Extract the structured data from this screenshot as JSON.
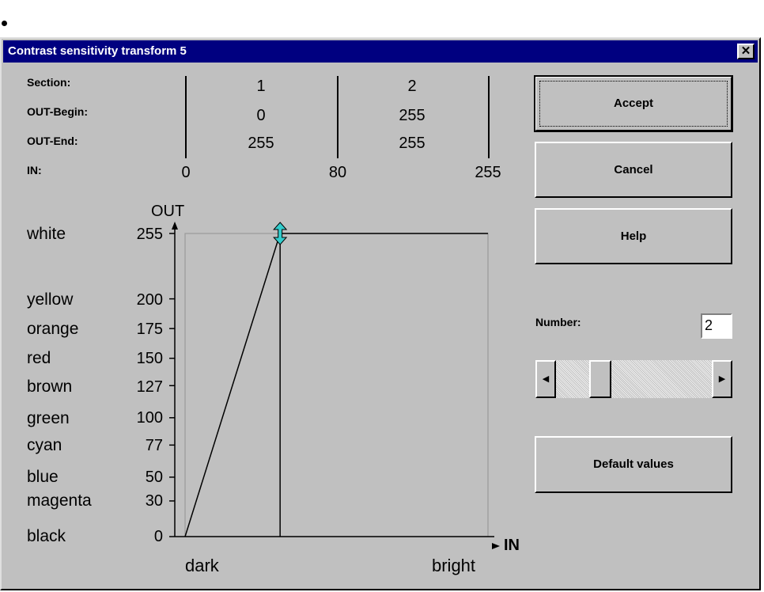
{
  "window": {
    "title": "Contrast sensitivity transform 5",
    "close_glyph": "✕"
  },
  "rows": {
    "section": "Section:",
    "out_begin": "OUT-Begin:",
    "out_end": "OUT-End:",
    "in": "IN:"
  },
  "sections": [
    {
      "number": "1",
      "out_begin": "0",
      "out_end": "255"
    },
    {
      "number": "2",
      "out_begin": "255",
      "out_end": "255"
    }
  ],
  "in_boundaries": [
    "0",
    "80",
    "255"
  ],
  "buttons": {
    "accept": "Accept",
    "cancel": "Cancel",
    "help": "Help",
    "default_values": "Default values"
  },
  "number_field": {
    "label": "Number:",
    "value": "2"
  },
  "scrollbar": {
    "left_arrow": "◀",
    "right_arrow": "▶",
    "position": 0.25
  },
  "graph": {
    "y_axis_label": "OUT",
    "x_axis_label": "IN",
    "x_left": "dark",
    "x_right": "bright",
    "levels": [
      {
        "color": "white",
        "value": "255"
      },
      {
        "color": "yellow",
        "value": "200"
      },
      {
        "color": "orange",
        "value": "175"
      },
      {
        "color": "red",
        "value": "150"
      },
      {
        "color": "brown",
        "value": "127"
      },
      {
        "color": "green",
        "value": "100"
      },
      {
        "color": "cyan",
        "value": "77"
      },
      {
        "color": "blue",
        "value": "50"
      },
      {
        "color": "magenta",
        "value": "30"
      },
      {
        "color": "black",
        "value": "0"
      }
    ],
    "curve_points": [
      [
        0,
        0
      ],
      [
        80,
        255
      ],
      [
        255,
        255
      ]
    ],
    "handle_icon": "vertical-double-arrow-icon",
    "handle_color": "#33cccc"
  },
  "colors": {
    "title_bar": "#000080",
    "dialog_bg": "#c0c0c0"
  }
}
